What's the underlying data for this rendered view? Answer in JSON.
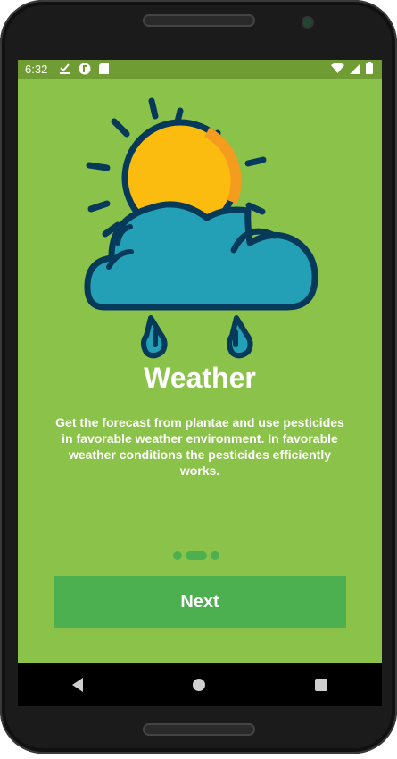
{
  "status_bar": {
    "time": "6:32",
    "left_icons": [
      "download-done-icon",
      "app-icon",
      "sd-card-icon"
    ],
    "right_icons": [
      "wifi-icon",
      "signal-icon",
      "battery-icon"
    ]
  },
  "onboarding": {
    "illustration": "weather-sun-cloud-rain-illustration",
    "title": "Weather",
    "description": "Get the forecast from plantae and use pesticides in favorable weather environment. In favorable weather conditions the pesticides efficiently works.",
    "page_indicator": {
      "total": 3,
      "current": 2
    },
    "next_label": "Next"
  },
  "navigation": [
    "back-icon",
    "home-icon",
    "recent-apps-icon"
  ],
  "colors": {
    "background": "#8bc34a",
    "status_bar": "#6f9c33",
    "button": "#4caf50",
    "sun": "#fbbc0f",
    "cloud": "#23a0b6",
    "outline": "#073a5a"
  }
}
